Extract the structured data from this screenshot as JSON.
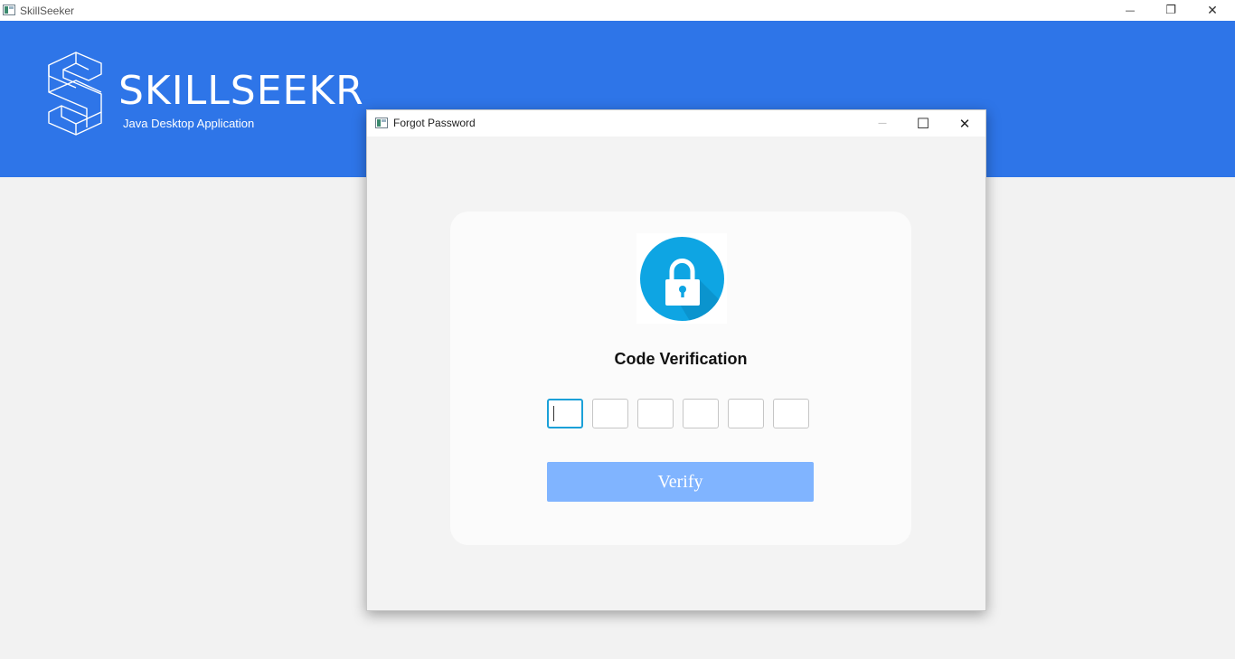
{
  "main_window": {
    "title": "SkillSeeker",
    "controls": {
      "minimize": "—",
      "restore": "❐",
      "close": "✕"
    }
  },
  "banner": {
    "brand": "SKILLSEEKR",
    "tagline": "Java Desktop Application",
    "color": "#2e75e8",
    "logo_icon": "isometric-s-logo-icon"
  },
  "dialog": {
    "title": "Forgot Password",
    "controls": {
      "minimize": "—",
      "maximize": "☐",
      "close": "✕"
    },
    "lock_icon": "padlock-icon",
    "heading": "Code Verification",
    "code_digits": [
      "",
      "",
      "",
      "",
      "",
      ""
    ],
    "verify_label": "Verify",
    "accent": "#0ea5e3",
    "button_color": "#80b4ff"
  }
}
